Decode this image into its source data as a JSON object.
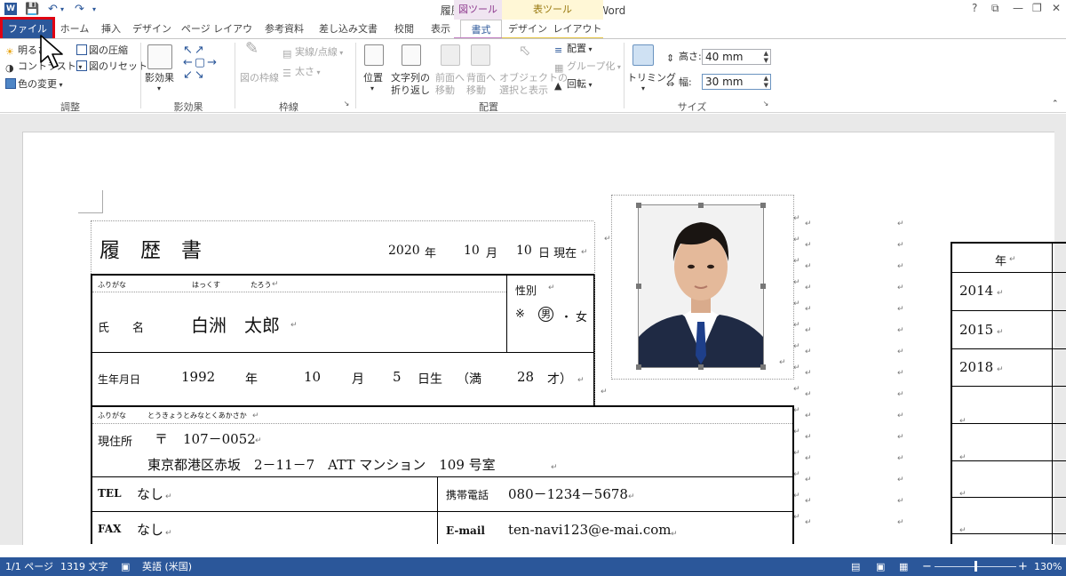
{
  "titlebar": {
    "title": "履歴書見本.docx [互換モード] - Word",
    "contextual_zu": "図ツール",
    "contextual_hyo": "表ツール",
    "help": "?",
    "ribbon_opts": "⧉",
    "minimize": "—",
    "restore": "❐",
    "close": "✕"
  },
  "tabs": {
    "file": "ファイル",
    "home": "ホーム",
    "insert": "挿入",
    "design": "デザイン",
    "page_layout": "ページ レイアウト",
    "references": "参考資料",
    "mailings": "差し込み文書",
    "review": "校閲",
    "view": "表示",
    "format": "書式",
    "table_design": "デザイン",
    "table_layout": "レイアウト"
  },
  "ribbon": {
    "adjust": {
      "brightness": "明るさ",
      "contrast": "コントラスト",
      "color": "色の変更",
      "compress": "図の圧縮",
      "reset": "図のリセット",
      "label": "調整"
    },
    "shadow": {
      "button": "影効果",
      "label": "影効果"
    },
    "border": {
      "frame": "図の枠線",
      "line_style": "実線/点線",
      "weight": "太さ",
      "label": "枠線"
    },
    "arrange": {
      "position": "位置",
      "wrap1": "文字列の",
      "wrap2": "折り返し",
      "forward1": "前面へ",
      "forward2": "移動",
      "backward1": "背面へ",
      "backward2": "移動",
      "select1": "オブジェクトの",
      "select2": "選択と表示",
      "align": "配置",
      "group": "グループ化",
      "rotate": "回転",
      "label": "配置"
    },
    "size": {
      "crop": "トリミング",
      "height_label": "高さ:",
      "height_value": "40 mm",
      "width_label": "幅:",
      "width_value": "30 mm",
      "label": "サイズ"
    }
  },
  "resume": {
    "title": "履　歴　書",
    "date_year": "2020",
    "date_year_unit": "年",
    "date_month": "10",
    "date_month_unit": "月",
    "date_day": "10",
    "date_suffix": "日 現在",
    "furigana_label": "ふりがな",
    "furigana_family": "はっくす",
    "furigana_given": "たろう",
    "name_label": "氏　　名",
    "name_value": "白洲　太郎",
    "gender_label": "性別",
    "gender_mark": "※",
    "gender_male": "男",
    "gender_sep": "・",
    "gender_female": "女",
    "birth_label": "生年月日",
    "birth_year": "1992",
    "birth_year_unit": "年",
    "birth_month": "10",
    "birth_month_unit": "月",
    "birth_day": "5",
    "birth_day_unit": "日生",
    "age_open": "（満",
    "age_value": "28",
    "age_close": "才）",
    "address_furigana_label": "ふりがな",
    "address_furigana": "とうきょうとみなとくあかさか",
    "address_label": "現住所",
    "postal_mark": "〒",
    "postal_code": "107－0052",
    "address": "東京都港区赤坂　2－11－7　ATT マンション　109 号室",
    "tel_label": "TEL",
    "tel_value": "なし",
    "mobile_label": "携帯電話",
    "mobile_value": "080－1234－5678",
    "fax_label": "FAX",
    "fax_value": "なし",
    "email_label": "E-mail",
    "email_value": "ten-navi123@e-mai.com",
    "history_header": "年",
    "history_years": [
      "2014",
      "2015",
      "2018"
    ]
  },
  "statusbar": {
    "page": "1/1 ページ",
    "words": "1319 文字",
    "language": "英語 (米国)",
    "zoom_minus": "−",
    "zoom_plus": "+",
    "zoom": "130%"
  },
  "colors": {
    "accent": "#2b579a",
    "file_highlight": "#e00012",
    "picture_tools": "#8e3a8e",
    "table_tools": "#9a7a10"
  },
  "icons": {
    "cursor": "arrow-cursor-icon",
    "word": "word-logo-icon",
    "save": "save-icon",
    "undo": "undo-icon",
    "redo": "redo-icon"
  }
}
